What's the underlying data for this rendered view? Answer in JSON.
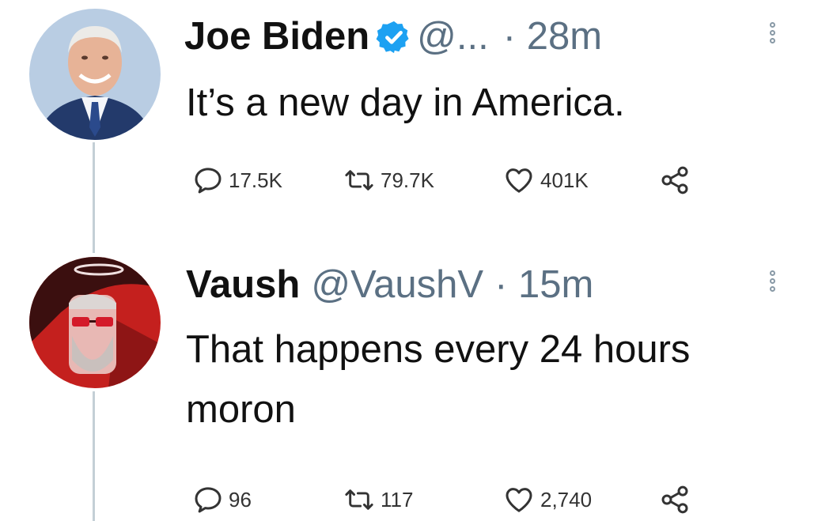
{
  "tweets": [
    {
      "author_name": "Joe Biden",
      "verified": true,
      "handle": "@...",
      "time": "· 28m",
      "text": "It’s a new day in America.",
      "stats": {
        "replies": "17.5K",
        "retweets": "79.7K",
        "likes": "401K"
      },
      "avatar_colors": {
        "bg": "#b9cde3",
        "suit": "#233a6b",
        "skin": "#e7b397"
      }
    },
    {
      "author_name": "Vaush",
      "verified": false,
      "handle": "@VaushV",
      "time": "· 15m",
      "text": "That happens every 24 hours moron",
      "stats": {
        "replies": "96",
        "retweets": "117",
        "likes": "2,740"
      },
      "avatar_colors": {
        "bg": "#c4201e",
        "dark": "#3b0f0f",
        "face": "#e8b8b4"
      }
    }
  ],
  "icons": [
    "verified-badge-icon",
    "more-options-icon",
    "reply-icon",
    "retweet-icon",
    "like-icon",
    "share-icon"
  ],
  "colors": {
    "verified": "#1da1f2",
    "thread_line": "#c4cfd6",
    "secondary_text": "#5b7083"
  }
}
